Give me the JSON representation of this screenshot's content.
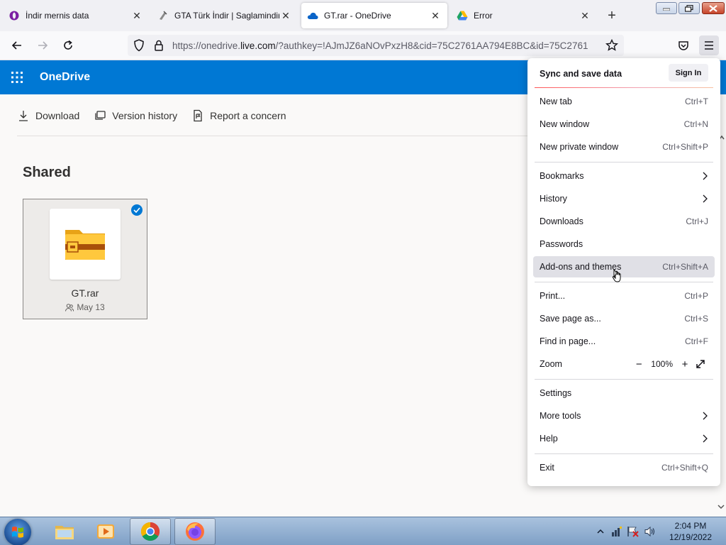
{
  "browser": {
    "tabs": [
      {
        "title": "İndir mernis data",
        "active": false
      },
      {
        "title": "GTA Türk İndir | Saglamindir",
        "active": false
      },
      {
        "title": "GT.rar - OneDrive",
        "active": true
      },
      {
        "title": "Error",
        "active": false
      }
    ],
    "new_tab_glyph": "+",
    "url": {
      "prefix": "https://onedrive.",
      "domain": "live.com",
      "suffix": "/?authkey=!AJmJZ6aNOvPxzH8&cid=75C2761AA794E8BC&id=75C2761"
    }
  },
  "onedrive": {
    "brand": "OneDrive",
    "commands": [
      {
        "label": "Download",
        "icon": "download-icon"
      },
      {
        "label": "Version history",
        "icon": "version-history-icon"
      },
      {
        "label": "Report a concern",
        "icon": "report-icon"
      }
    ],
    "heading": "Shared",
    "file": {
      "name": "GT.rar",
      "date": "May 13",
      "selected": true
    }
  },
  "menu": {
    "sync_label": "Sync and save data",
    "sign_in": "Sign In",
    "items": [
      {
        "label": "New tab",
        "shortcut": "Ctrl+T"
      },
      {
        "label": "New window",
        "shortcut": "Ctrl+N"
      },
      {
        "label": "New private window",
        "shortcut": "Ctrl+Shift+P"
      },
      {
        "label": "Bookmarks",
        "shortcut": ""
      },
      {
        "label": "History",
        "shortcut": ""
      },
      {
        "label": "Downloads",
        "shortcut": "Ctrl+J"
      },
      {
        "label": "Passwords",
        "shortcut": ""
      },
      {
        "label": "Add-ons and themes",
        "shortcut": "Ctrl+Shift+A"
      },
      {
        "label": "Print...",
        "shortcut": "Ctrl+P"
      },
      {
        "label": "Save page as...",
        "shortcut": "Ctrl+S"
      },
      {
        "label": "Find in page...",
        "shortcut": "Ctrl+F"
      },
      {
        "label": "Zoom",
        "shortcut": ""
      },
      {
        "label": "Settings",
        "shortcut": ""
      },
      {
        "label": "More tools",
        "shortcut": ""
      },
      {
        "label": "Help",
        "shortcut": ""
      },
      {
        "label": "Exit",
        "shortcut": "Ctrl+Shift+Q"
      }
    ],
    "zoom_minus": "−",
    "zoom_level": "100%",
    "zoom_plus": "+"
  },
  "taskbar": {
    "time": "2:04 PM",
    "date": "12/19/2022"
  },
  "colors": {
    "onedrive_blue": "#0078d4",
    "menu_hover": "#e0e0e6",
    "folder_yellow": "#ffc83d"
  }
}
